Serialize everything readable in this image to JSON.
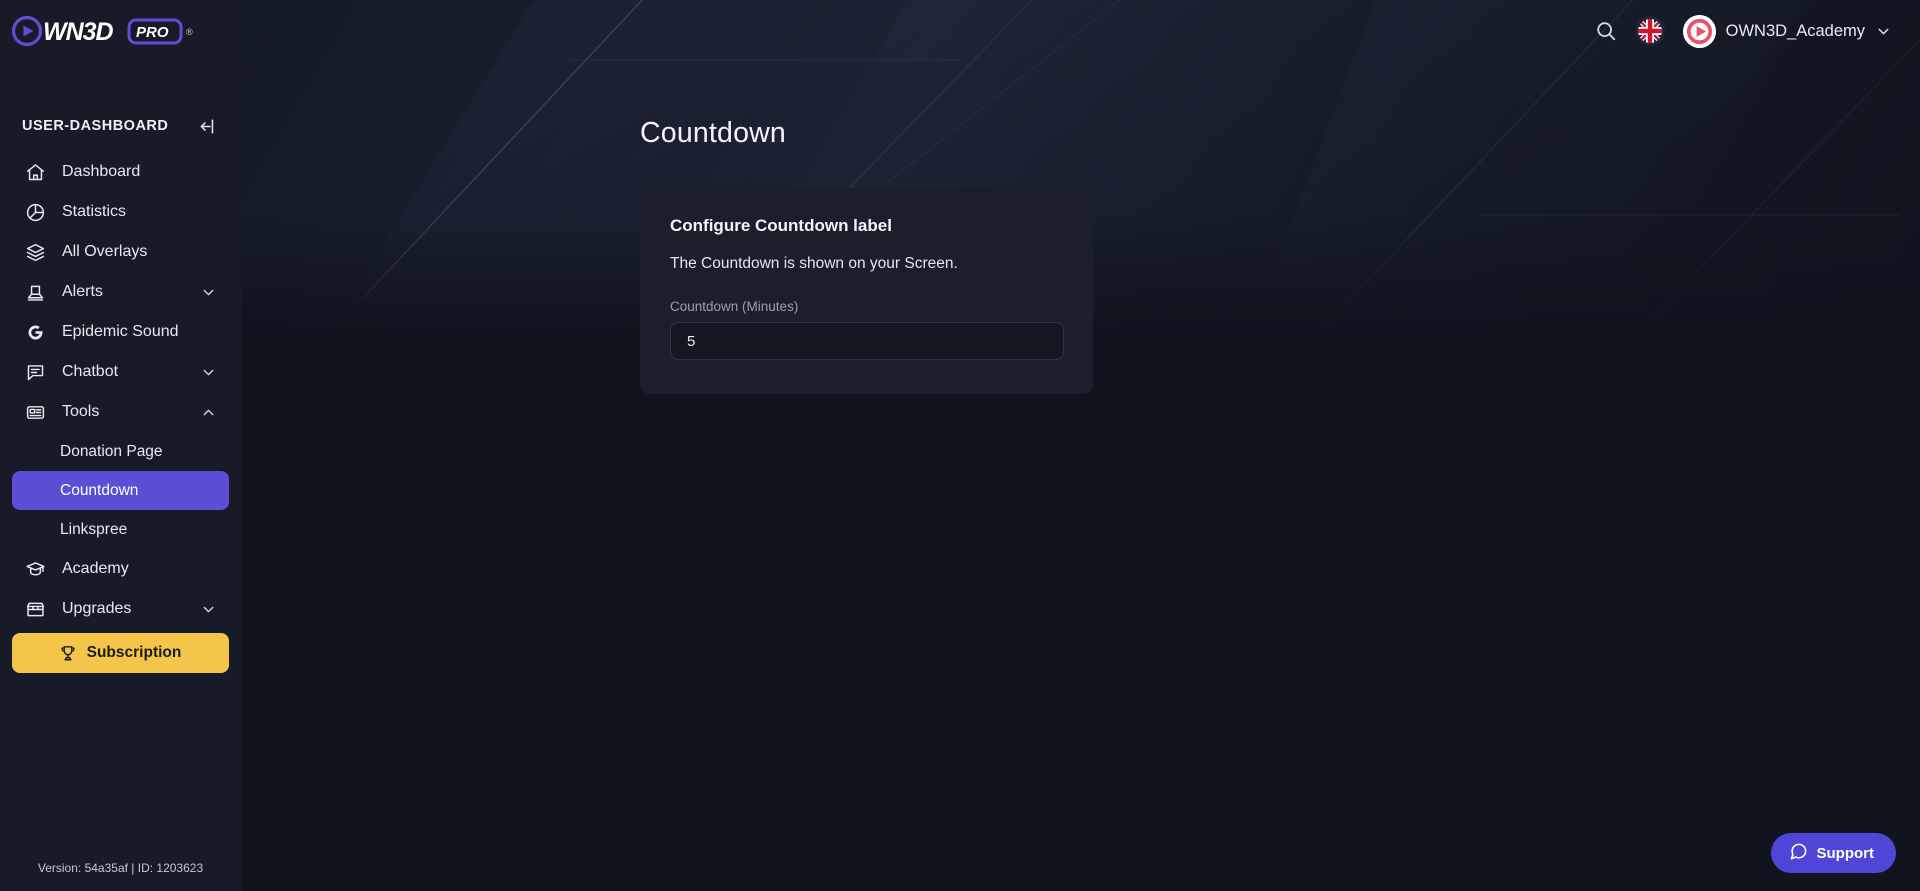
{
  "brand": {
    "logo_text": "OWN3D",
    "logo_badge": "PRO",
    "logo_registered": "®",
    "accent_purple": "#5b4fd6",
    "accent_yellow": "#f3c64b",
    "support_purple": "#4f46d8"
  },
  "topbar": {
    "search_icon": "search-icon",
    "language_flag": "uk-flag-icon",
    "avatar_icon": "own3d-avatar-icon",
    "user_name": "OWN3D_Academy",
    "user_chevron": "chevron-down-icon"
  },
  "sidebar": {
    "section_title": "USER-DASHBOARD",
    "collapse_icon": "collapse-left-icon",
    "items": [
      {
        "label": "Dashboard",
        "icon": "home-icon",
        "level": 0,
        "active": false,
        "chevron": ""
      },
      {
        "label": "Statistics",
        "icon": "pie-chart-icon",
        "level": 0,
        "active": false,
        "chevron": ""
      },
      {
        "label": "All Overlays",
        "icon": "layers-icon",
        "level": 0,
        "active": false,
        "chevron": ""
      },
      {
        "label": "Alerts",
        "icon": "alert-lamp-icon",
        "level": 0,
        "active": false,
        "chevron": "chevron-down-icon"
      },
      {
        "label": "Epidemic Sound",
        "icon": "epidemic-sound-icon",
        "level": 0,
        "active": false,
        "chevron": ""
      },
      {
        "label": "Chatbot",
        "icon": "chat-bubble-icon",
        "level": 0,
        "active": false,
        "chevron": "chevron-down-icon"
      },
      {
        "label": "Tools",
        "icon": "tools-card-icon",
        "level": 0,
        "active": false,
        "chevron": "chevron-up-icon"
      },
      {
        "label": "Donation Page",
        "icon": "",
        "level": 1,
        "active": false,
        "chevron": ""
      },
      {
        "label": "Countdown",
        "icon": "",
        "level": 1,
        "active": true,
        "chevron": ""
      },
      {
        "label": "Linkspree",
        "icon": "",
        "level": 1,
        "active": false,
        "chevron": ""
      },
      {
        "label": "Academy",
        "icon": "graduation-cap-icon",
        "level": 0,
        "active": false,
        "chevron": ""
      },
      {
        "label": "Upgrades",
        "icon": "store-icon",
        "level": 0,
        "active": false,
        "chevron": "chevron-down-icon"
      }
    ],
    "subscription": {
      "label": "Subscription",
      "icon": "trophy-icon"
    },
    "version_text": "Version: 54a35af | ID: 1203623"
  },
  "main": {
    "page_title": "Countdown",
    "card": {
      "title": "Configure Countdown label",
      "subtitle": "The Countdown is shown on your Screen.",
      "field_label": "Countdown (Minutes)",
      "field_value": "5",
      "field_placeholder": "5"
    }
  },
  "support": {
    "label": "Support",
    "icon": "chat-bubble-icon"
  }
}
